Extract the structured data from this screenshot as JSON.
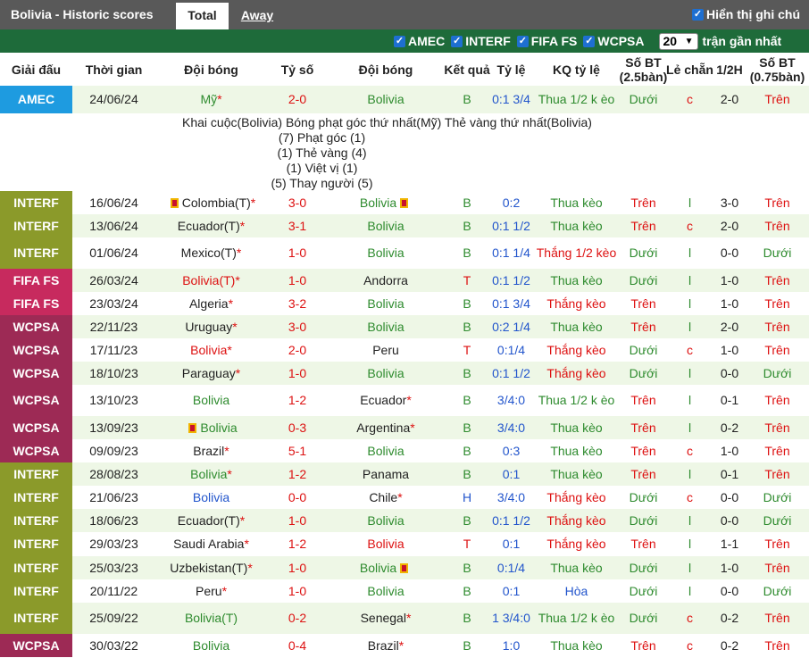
{
  "header": {
    "title": "Bolivia - Historic scores",
    "tab_total": "Total",
    "tab_away": "Away",
    "show_notes": "Hiển thị ghi chú"
  },
  "filters": {
    "items": [
      "AMEC",
      "INTERF",
      "FIFA FS",
      "WCPSA"
    ],
    "count": "20",
    "recent_label": "trận gần nhất"
  },
  "columns": {
    "league": "Giải đấu",
    "date": "Thời gian",
    "home": "Đội bóng",
    "score": "Tỷ số",
    "away": "Đội bóng",
    "result": "Kết quả",
    "handicap": "Tỷ lệ",
    "handicap_result": "KQ tỷ lệ",
    "ou": "Số BT (2.5bàn)",
    "odd_even": "Lẻ chẵn",
    "half": "1/2H",
    "ou2": "Số BT (0.75bàn)"
  },
  "colors": {
    "AMEC": "#1e9be0",
    "INTERF": "#8b9a2a",
    "FIFA FS": "#c72a5e",
    "WCPSA": "#9d2a55",
    "row_alt": "#eef7e6",
    "win_green": "#2e8b2e",
    "lose_red": "#d11111"
  },
  "detail": {
    "legend": "Khai cuộc(Bolivia)   Bóng phạt góc thứ nhất(Mỹ)   Thẻ vàng thứ nhất(Bolivia)",
    "stats": [
      "(7) Phạt góc (1)",
      "(1) Thẻ vàng (4)",
      "(1) Việt vị (1)",
      "(5) Thay người (5)"
    ]
  },
  "rows": [
    {
      "league": "AMEC",
      "date": "24/06/24",
      "home": "Mỹ",
      "home_star": "*",
      "home_color": "green",
      "home_card": false,
      "score": "2-0",
      "away": "Bolivia",
      "away_star": "",
      "away_color": "green",
      "away_card": false,
      "res": "B",
      "res_color": "green",
      "hc": "0:1 3/4",
      "hcr": "Thua 1/2 k èo",
      "hcr_color": "green",
      "ou": "Dưới",
      "ou_color": "green",
      "oe": "c",
      "oe_color": "red",
      "half": "2-0",
      "ou2": "Trên",
      "ou2_color": "red"
    },
    {
      "league": "INTERF",
      "date": "16/06/24",
      "home": "Colombia(T)",
      "home_star": "*",
      "home_color": "dark",
      "home_card": true,
      "score": "3-0",
      "away": "Bolivia",
      "away_star": "",
      "away_color": "green",
      "away_card": true,
      "res": "B",
      "res_color": "green",
      "hc": "0:2",
      "hcr": "Thua kèo",
      "hcr_color": "green",
      "ou": "Trên",
      "ou_color": "red",
      "oe": "l",
      "oe_color": "green",
      "half": "3-0",
      "ou2": "Trên",
      "ou2_color": "red"
    },
    {
      "league": "INTERF",
      "date": "13/06/24",
      "home": "Ecuador(T)",
      "home_star": "*",
      "home_color": "dark",
      "home_card": false,
      "score": "3-1",
      "away": "Bolivia",
      "away_star": "",
      "away_color": "green",
      "away_card": false,
      "res": "B",
      "res_color": "green",
      "hc": "0:1 1/2",
      "hcr": "Thua kèo",
      "hcr_color": "green",
      "ou": "Trên",
      "ou_color": "red",
      "oe": "c",
      "oe_color": "red",
      "half": "2-0",
      "ou2": "Trên",
      "ou2_color": "red"
    },
    {
      "league": "INTERF",
      "date": "01/06/24",
      "home": "Mexico(T)",
      "home_star": "*",
      "home_color": "dark",
      "home_card": false,
      "score": "1-0",
      "away": "Bolivia",
      "away_star": "",
      "away_color": "green",
      "away_card": false,
      "res": "B",
      "res_color": "green",
      "hc": "0:1 1/4",
      "hcr": "Thắng 1/2 kèo",
      "hcr_color": "red",
      "ou": "Dưới",
      "ou_color": "green",
      "oe": "l",
      "oe_color": "green",
      "half": "0-0",
      "ou2": "Dưới",
      "ou2_color": "green"
    },
    {
      "league": "FIFA FS",
      "date": "26/03/24",
      "home": "Bolivia(T)",
      "home_star": "*",
      "home_color": "red",
      "home_card": false,
      "score": "1-0",
      "away": "Andorra",
      "away_star": "",
      "away_color": "dark",
      "away_card": false,
      "res": "T",
      "res_color": "red",
      "hc": "0:1 1/2",
      "hcr": "Thua kèo",
      "hcr_color": "green",
      "ou": "Dưới",
      "ou_color": "green",
      "oe": "l",
      "oe_color": "green",
      "half": "1-0",
      "ou2": "Trên",
      "ou2_color": "red"
    },
    {
      "league": "FIFA FS",
      "date": "23/03/24",
      "home": "Algeria",
      "home_star": "*",
      "home_color": "dark",
      "home_card": false,
      "score": "3-2",
      "away": "Bolivia",
      "away_star": "",
      "away_color": "green",
      "away_card": false,
      "res": "B",
      "res_color": "green",
      "hc": "0:1 3/4",
      "hcr": "Thắng kèo",
      "hcr_color": "red",
      "ou": "Trên",
      "ou_color": "red",
      "oe": "l",
      "oe_color": "green",
      "half": "1-0",
      "ou2": "Trên",
      "ou2_color": "red"
    },
    {
      "league": "WCPSA",
      "date": "22/11/23",
      "home": "Uruguay",
      "home_star": "*",
      "home_color": "dark",
      "home_card": false,
      "score": "3-0",
      "away": "Bolivia",
      "away_star": "",
      "away_color": "green",
      "away_card": false,
      "res": "B",
      "res_color": "green",
      "hc": "0:2 1/4",
      "hcr": "Thua kèo",
      "hcr_color": "green",
      "ou": "Trên",
      "ou_color": "red",
      "oe": "l",
      "oe_color": "green",
      "half": "2-0",
      "ou2": "Trên",
      "ou2_color": "red"
    },
    {
      "league": "WCPSA",
      "date": "17/11/23",
      "home": "Bolivia",
      "home_star": "*",
      "home_color": "red",
      "home_card": false,
      "score": "2-0",
      "away": "Peru",
      "away_star": "",
      "away_color": "dark",
      "away_card": false,
      "res": "T",
      "res_color": "red",
      "hc": "0:1/4",
      "hcr": "Thắng kèo",
      "hcr_color": "red",
      "ou": "Dưới",
      "ou_color": "green",
      "oe": "c",
      "oe_color": "red",
      "half": "1-0",
      "ou2": "Trên",
      "ou2_color": "red"
    },
    {
      "league": "WCPSA",
      "date": "18/10/23",
      "home": "Paraguay",
      "home_star": "*",
      "home_color": "dark",
      "home_card": false,
      "score": "1-0",
      "away": "Bolivia",
      "away_star": "",
      "away_color": "green",
      "away_card": false,
      "res": "B",
      "res_color": "green",
      "hc": "0:1 1/2",
      "hcr": "Thắng kèo",
      "hcr_color": "red",
      "ou": "Dưới",
      "ou_color": "green",
      "oe": "l",
      "oe_color": "green",
      "half": "0-0",
      "ou2": "Dưới",
      "ou2_color": "green"
    },
    {
      "league": "WCPSA",
      "date": "13/10/23",
      "home": "Bolivia",
      "home_star": "",
      "home_color": "green",
      "home_card": false,
      "score": "1-2",
      "away": "Ecuador",
      "away_star": "*",
      "away_color": "dark",
      "away_card": false,
      "res": "B",
      "res_color": "green",
      "hc": "3/4:0",
      "hcr": "Thua 1/2 k èo",
      "hcr_color": "green",
      "ou": "Trên",
      "ou_color": "red",
      "oe": "l",
      "oe_color": "green",
      "half": "0-1",
      "ou2": "Trên",
      "ou2_color": "red"
    },
    {
      "league": "WCPSA",
      "date": "13/09/23",
      "home": "Bolivia",
      "home_star": "",
      "home_color": "green",
      "home_card": true,
      "score": "0-3",
      "away": "Argentina",
      "away_star": "*",
      "away_color": "dark",
      "away_card": false,
      "res": "B",
      "res_color": "green",
      "hc": "3/4:0",
      "hcr": "Thua kèo",
      "hcr_color": "green",
      "ou": "Trên",
      "ou_color": "red",
      "oe": "l",
      "oe_color": "green",
      "half": "0-2",
      "ou2": "Trên",
      "ou2_color": "red"
    },
    {
      "league": "WCPSA",
      "date": "09/09/23",
      "home": "Brazil",
      "home_star": "*",
      "home_color": "dark",
      "home_card": false,
      "score": "5-1",
      "away": "Bolivia",
      "away_star": "",
      "away_color": "green",
      "away_card": false,
      "res": "B",
      "res_color": "green",
      "hc": "0:3",
      "hcr": "Thua kèo",
      "hcr_color": "green",
      "ou": "Trên",
      "ou_color": "red",
      "oe": "c",
      "oe_color": "red",
      "half": "1-0",
      "ou2": "Trên",
      "ou2_color": "red"
    },
    {
      "league": "INTERF",
      "date": "28/08/23",
      "home": "Bolivia",
      "home_star": "*",
      "home_color": "green",
      "home_card": false,
      "score": "1-2",
      "away": "Panama",
      "away_star": "",
      "away_color": "dark",
      "away_card": false,
      "res": "B",
      "res_color": "green",
      "hc": "0:1",
      "hcr": "Thua kèo",
      "hcr_color": "green",
      "ou": "Trên",
      "ou_color": "red",
      "oe": "l",
      "oe_color": "green",
      "half": "0-1",
      "ou2": "Trên",
      "ou2_color": "red"
    },
    {
      "league": "INTERF",
      "date": "21/06/23",
      "home": "Bolivia",
      "home_star": "",
      "home_color": "blue",
      "home_card": false,
      "score": "0-0",
      "away": "Chile",
      "away_star": "*",
      "away_color": "dark",
      "away_card": false,
      "res": "H",
      "res_color": "blue",
      "hc": "3/4:0",
      "hcr": "Thắng kèo",
      "hcr_color": "red",
      "ou": "Dưới",
      "ou_color": "green",
      "oe": "c",
      "oe_color": "red",
      "half": "0-0",
      "ou2": "Dưới",
      "ou2_color": "green"
    },
    {
      "league": "INTERF",
      "date": "18/06/23",
      "home": "Ecuador(T)",
      "home_star": "*",
      "home_color": "dark",
      "home_card": false,
      "score": "1-0",
      "away": "Bolivia",
      "away_star": "",
      "away_color": "green",
      "away_card": false,
      "res": "B",
      "res_color": "green",
      "hc": "0:1 1/2",
      "hcr": "Thắng kèo",
      "hcr_color": "red",
      "ou": "Dưới",
      "ou_color": "green",
      "oe": "l",
      "oe_color": "green",
      "half": "0-0",
      "ou2": "Dưới",
      "ou2_color": "green"
    },
    {
      "league": "INTERF",
      "date": "29/03/23",
      "home": "Saudi Arabia",
      "home_star": "*",
      "home_color": "dark",
      "home_card": false,
      "score": "1-2",
      "away": "Bolivia",
      "away_star": "",
      "away_color": "red",
      "away_card": false,
      "res": "T",
      "res_color": "red",
      "hc": "0:1",
      "hcr": "Thắng kèo",
      "hcr_color": "red",
      "ou": "Trên",
      "ou_color": "red",
      "oe": "l",
      "oe_color": "green",
      "half": "1-1",
      "ou2": "Trên",
      "ou2_color": "red"
    },
    {
      "league": "INTERF",
      "date": "25/03/23",
      "home": "Uzbekistan(T)",
      "home_star": "*",
      "home_color": "dark",
      "home_card": false,
      "score": "1-0",
      "away": "Bolivia",
      "away_star": "",
      "away_color": "green",
      "away_card": true,
      "res": "B",
      "res_color": "green",
      "hc": "0:1/4",
      "hcr": "Thua kèo",
      "hcr_color": "green",
      "ou": "Dưới",
      "ou_color": "green",
      "oe": "l",
      "oe_color": "green",
      "half": "1-0",
      "ou2": "Trên",
      "ou2_color": "red"
    },
    {
      "league": "INTERF",
      "date": "20/11/22",
      "home": "Peru",
      "home_star": "*",
      "home_color": "dark",
      "home_card": false,
      "score": "1-0",
      "away": "Bolivia",
      "away_star": "",
      "away_color": "green",
      "away_card": false,
      "res": "B",
      "res_color": "green",
      "hc": "0:1",
      "hcr": "Hòa",
      "hcr_color": "blue",
      "ou": "Dưới",
      "ou_color": "green",
      "oe": "l",
      "oe_color": "green",
      "half": "0-0",
      "ou2": "Dưới",
      "ou2_color": "green"
    },
    {
      "league": "INTERF",
      "date": "25/09/22",
      "home": "Bolivia(T)",
      "home_star": "",
      "home_color": "green",
      "home_card": false,
      "score": "0-2",
      "away": "Senegal",
      "away_star": "*",
      "away_color": "dark",
      "away_card": false,
      "res": "B",
      "res_color": "green",
      "hc": "1 3/4:0",
      "hcr": "Thua 1/2 k èo",
      "hcr_color": "green",
      "ou": "Dưới",
      "ou_color": "green",
      "oe": "c",
      "oe_color": "red",
      "half": "0-2",
      "ou2": "Trên",
      "ou2_color": "red"
    },
    {
      "league": "WCPSA",
      "date": "30/03/22",
      "home": "Bolivia",
      "home_star": "",
      "home_color": "green",
      "home_card": false,
      "score": "0-4",
      "away": "Brazil",
      "away_star": "*",
      "away_color": "dark",
      "away_card": false,
      "res": "B",
      "res_color": "green",
      "hc": "1:0",
      "hcr": "Thua kèo",
      "hcr_color": "green",
      "ou": "Trên",
      "ou_color": "red",
      "oe": "c",
      "oe_color": "red",
      "half": "0-2",
      "ou2": "Trên",
      "ou2_color": "red"
    }
  ]
}
